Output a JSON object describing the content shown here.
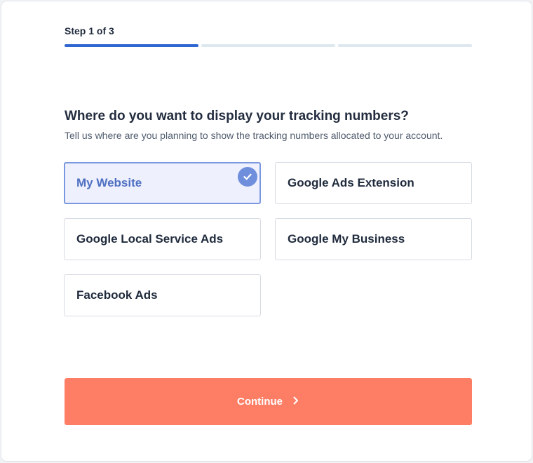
{
  "stepper": {
    "label": "Step 1 of 3",
    "total_steps": 3,
    "current_step": 1,
    "active_color": "#2f66d0",
    "inactive_color": "#dde9ef"
  },
  "question": {
    "title": "Where do you want to display your tracking numbers?",
    "subtitle": "Tell us where are you planning to show the tracking numbers allocated to your account."
  },
  "options": [
    {
      "label": "My Website",
      "selected": true
    },
    {
      "label": "Google Ads Extension",
      "selected": false
    },
    {
      "label": "Google Local Service Ads",
      "selected": false
    },
    {
      "label": "Google My Business",
      "selected": false
    },
    {
      "label": "Facebook Ads",
      "selected": false
    }
  ],
  "continue_button": {
    "label": "Continue",
    "icon": "chevron-right-icon",
    "color": "#fe7e65"
  },
  "colors": {
    "selected_background": "#eef0fd",
    "selected_border": "#7a98e0",
    "check_badge": "#6f8fdc"
  }
}
